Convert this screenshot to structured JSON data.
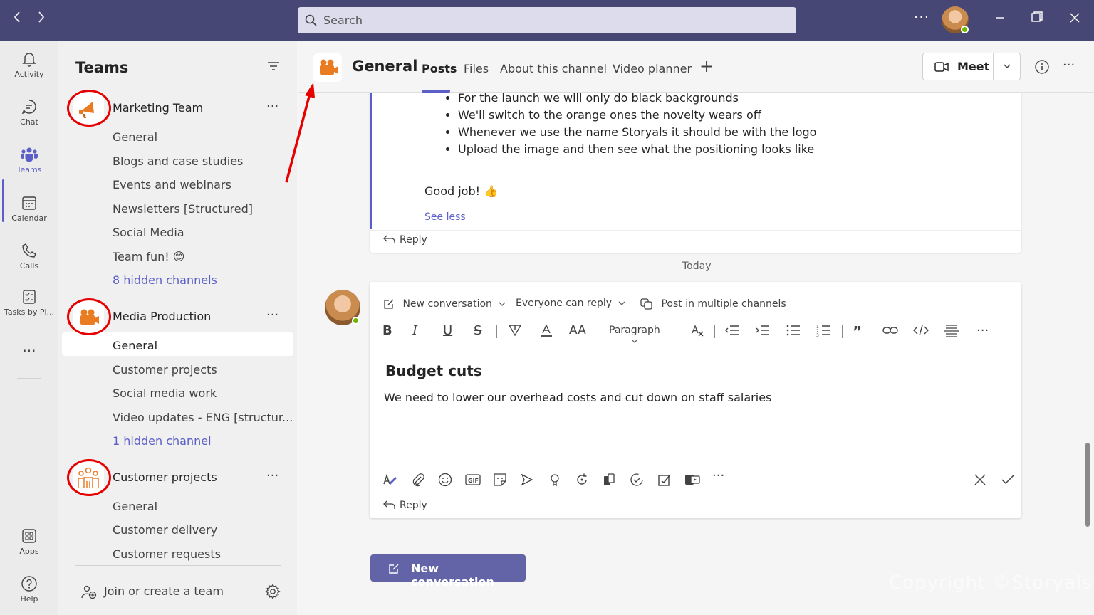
{
  "titlebar": {
    "back_icon": "chevron-left-icon",
    "forward_icon": "chevron-right-icon",
    "search_placeholder": "Search",
    "more_label": "···"
  },
  "rail": {
    "items": [
      {
        "label": "Activity",
        "icon": "bell-icon"
      },
      {
        "label": "Chat",
        "icon": "chat-icon"
      },
      {
        "label": "Teams",
        "icon": "teams-icon"
      },
      {
        "label": "Calendar",
        "icon": "calendar-icon"
      },
      {
        "label": "Calls",
        "icon": "phone-icon"
      },
      {
        "label": "Tasks by Pl...",
        "icon": "tasks-icon"
      }
    ],
    "more": "···",
    "apps": "Apps",
    "help": "Help"
  },
  "teams_panel": {
    "title": "Teams",
    "teams": [
      {
        "name": "Marketing Team",
        "channels": [
          "General",
          "Blogs and case studies",
          "Events and webinars",
          "Newsletters [Structured]",
          "Social Media",
          "Team fun! 😊"
        ],
        "hidden": "8 hidden channels"
      },
      {
        "name": "Media Production",
        "channels": [
          "General",
          "Customer projects",
          "Social media work",
          "Video updates - ENG [structur..."
        ],
        "hidden": "1 hidden channel"
      },
      {
        "name": "Customer projects",
        "channels": [
          "General",
          "Customer delivery",
          "Customer requests"
        ]
      }
    ],
    "more": "···",
    "join_label": "Join or create a team"
  },
  "channel_header": {
    "name": "General",
    "tabs": [
      "Posts",
      "Files",
      "About this channel",
      "Video planner"
    ],
    "add_tab": "+",
    "meet_label": "Meet",
    "more": "···"
  },
  "message": {
    "bullets": [
      "For the launch we will only do black backgrounds",
      "We'll switch to the orange ones the novelty wears off",
      "Whenever we use the name Storyals it should be with the logo",
      "Upload the image and then see what the positioning looks like"
    ],
    "closing": "Good job! 👍",
    "see_less": "See less",
    "reply": "Reply"
  },
  "divider": {
    "label": "Today"
  },
  "compose": {
    "type_label": "New conversation",
    "reply_setting": "Everyone can reply",
    "multi_post": "Post in multiple channels",
    "paragraph_label": "Paragraph",
    "subject": "Budget cuts",
    "body": "We need to lower our overhead costs and cut down on staff salaries",
    "reply": "Reply",
    "more": "···"
  },
  "new_conversation_button": "New conversation",
  "watermark": "Copyright ©Storyals",
  "colors": {
    "titlebar": "#464775",
    "accent": "#5b5fc7",
    "button": "#6264a7",
    "team_orange": "#e97b20",
    "annotation_red": "#e60000"
  }
}
